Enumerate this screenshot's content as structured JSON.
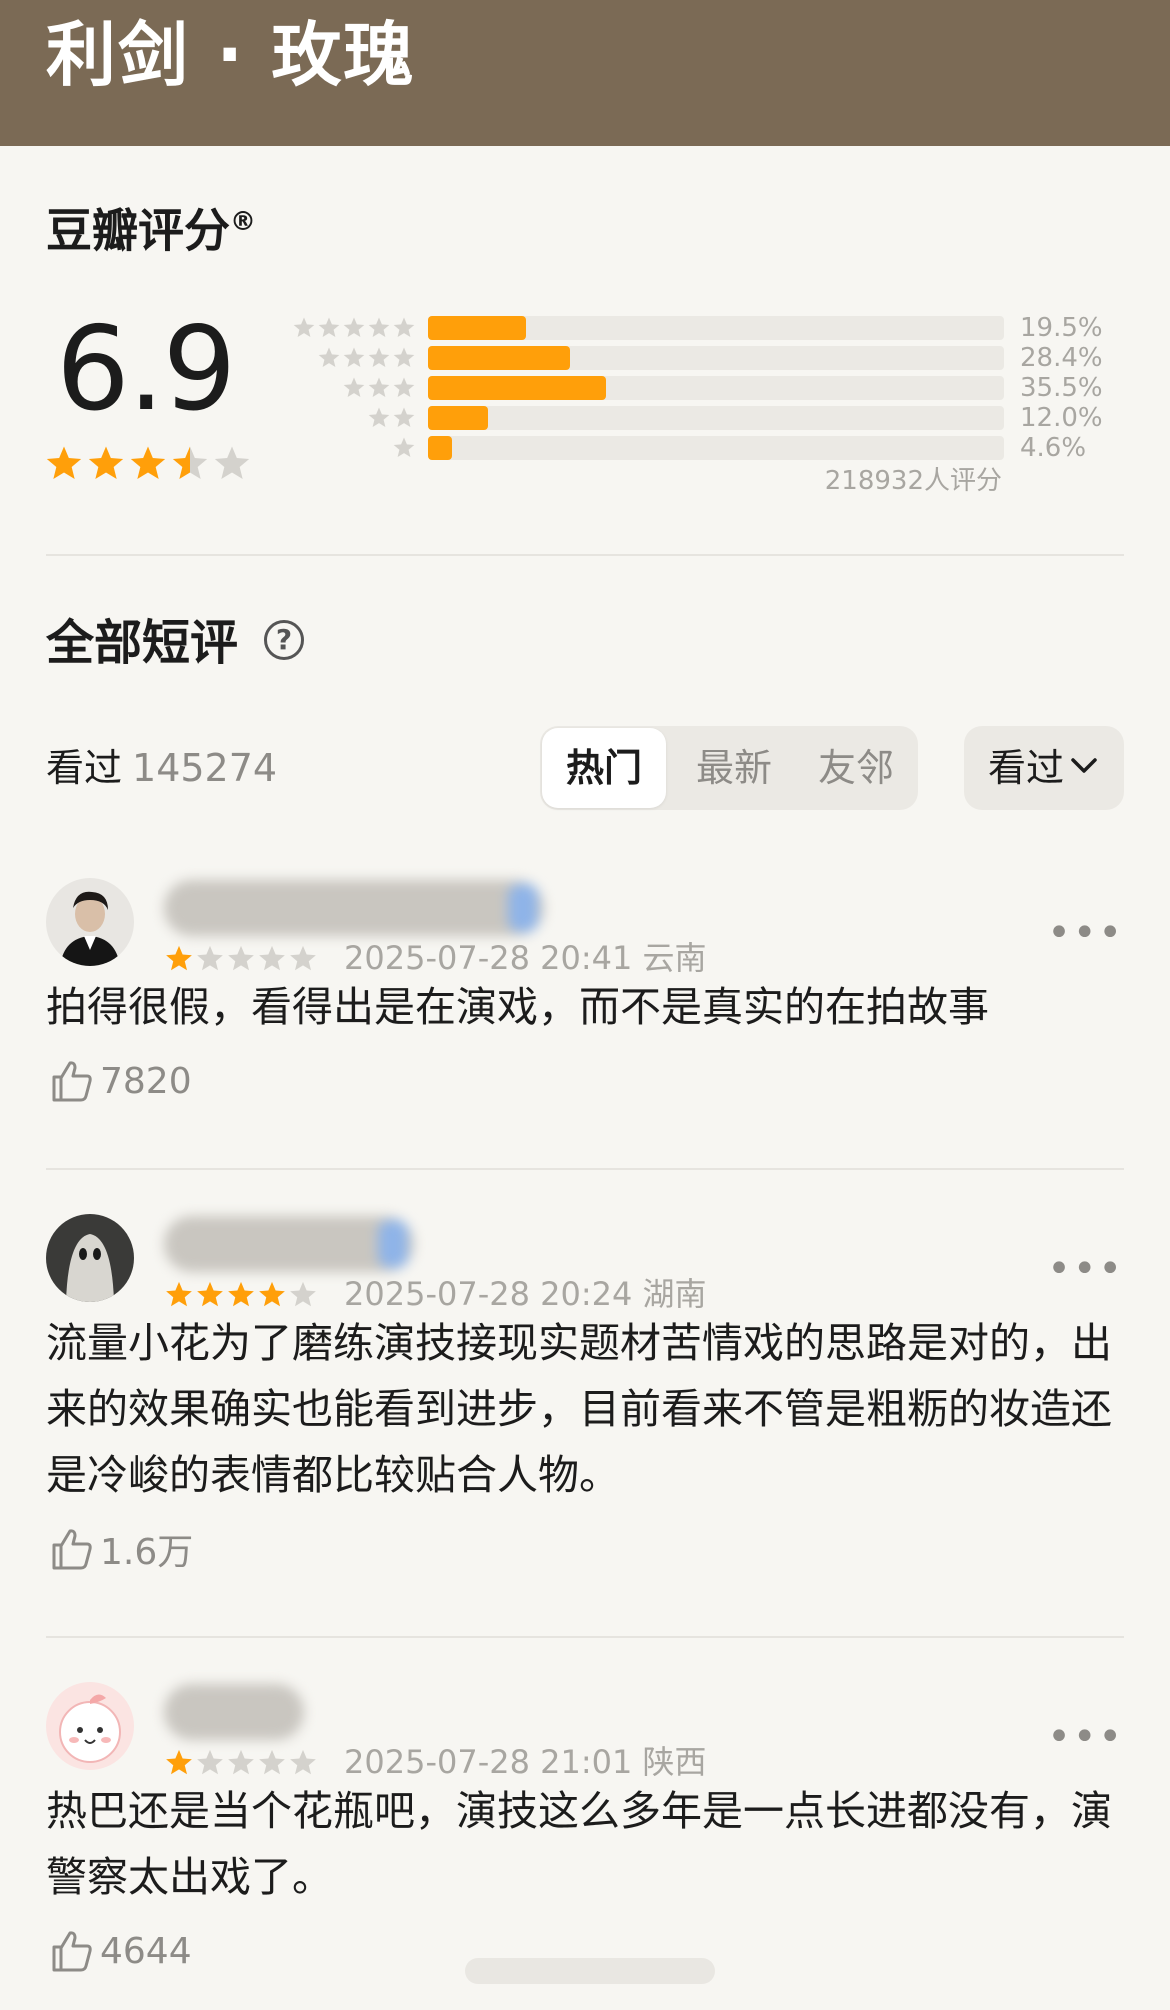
{
  "header": {
    "title": "利剑 · 玫瑰",
    "bg_color": "#7b6a55"
  },
  "rating": {
    "title": "豆瓣评分",
    "registered": "®",
    "score": "6.9",
    "score_stars": 3.5,
    "distribution": [
      {
        "stars": 5,
        "percent": 19.5,
        "label": "19.5%"
      },
      {
        "stars": 4,
        "percent": 28.4,
        "label": "28.4%"
      },
      {
        "stars": 3,
        "percent": 35.5,
        "label": "35.5%"
      },
      {
        "stars": 2,
        "percent": 12.0,
        "label": "12.0%"
      },
      {
        "stars": 1,
        "percent": 4.6,
        "label": "4.6%"
      }
    ],
    "total_ratings": "218932人评分",
    "bar_color": "#ff9f0a"
  },
  "reviews_section": {
    "title": "全部短评",
    "help_icon": "question-circle-icon",
    "watched_label": "看过",
    "watched_count": "145274",
    "tabs": [
      {
        "label": "热门",
        "active": true
      },
      {
        "label": "最新",
        "active": false
      },
      {
        "label": "友邻",
        "active": false
      }
    ],
    "filter_label": "看过"
  },
  "reviews": [
    {
      "rating": 1,
      "date": "2025-07-28 20:41",
      "location": "云南",
      "text": "拍得很假，看得出是在演戏，而不是真实的在拍故事",
      "likes": "7820"
    },
    {
      "rating": 4,
      "date": "2025-07-28 20:24",
      "location": "湖南",
      "text": "流量小花为了磨练演技接现实题材苦情戏的思路是对的，出来的效果确实也能看到进步，目前看来不管是粗粝的妆造还是冷峻的表情都比较贴合人物。",
      "likes": "1.6万"
    },
    {
      "rating": 1,
      "date": "2025-07-28 21:01",
      "location": "陕西",
      "text": "热巴还是当个花瓶吧，演技这么多年是一点长进都没有，演警察太出戏了。",
      "likes": "4644"
    }
  ]
}
